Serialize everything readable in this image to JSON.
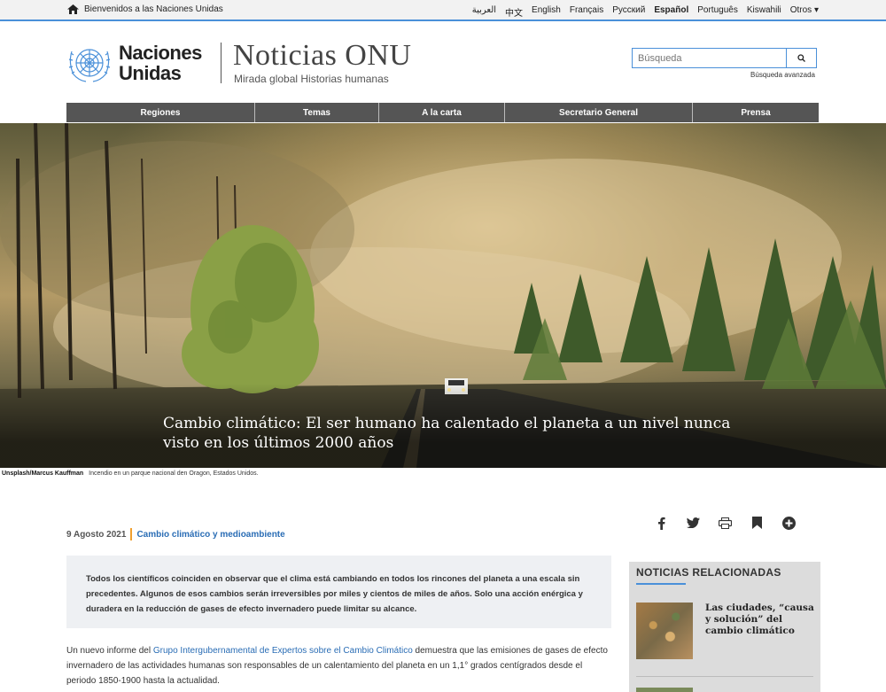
{
  "topbar": {
    "welcome": "Bienvenidos a las Naciones Unidas",
    "languages": [
      "العربية",
      "中文",
      "English",
      "Français",
      "Русский",
      "Español",
      "Português",
      "Kiswahili"
    ],
    "active_language": "Español",
    "more": "Otros"
  },
  "header": {
    "brand_line1": "Naciones",
    "brand_line2": "Unidas",
    "title": "Noticias ONU",
    "subtitle": "Mirada global Historias humanas",
    "search_placeholder": "Búsqueda",
    "advanced_search": "Búsqueda avanzada"
  },
  "nav": [
    "Regiones",
    "Temas",
    "A la carta",
    "Secretario General",
    "Prensa"
  ],
  "hero": {
    "title": "Cambio climático: El ser humano ha calentado el planeta a un nivel nunca visto en los últimos 2000 años",
    "credit_source": "Unsplash/Marcus Kauffman",
    "credit_caption": "Incendio en un parque nacional den Oragon, Estados Unidos."
  },
  "article": {
    "date": "9 Agosto 2021",
    "category": "Cambio climático y medioambiente",
    "summary": "Todos los científicos coinciden en observar que el clima está cambiando en todos los rincones del planeta a una escala sin precedentes. Algunos de esos cambios serán irreversibles por miles y cientos de miles de años. Solo una acción enérgica y duradera en la reducción de gases de efecto invernadero puede limitar su alcance.",
    "body_prefix": "Un nuevo informe del ",
    "body_link": "Grupo Intergubernamental de Expertos sobre el Cambio Climático",
    "body_suffix": " demuestra que las emisiones de gases de efecto invernadero de las actividades humanas son responsables de un calentamiento del planeta en un 1,1° grados centígrados desde el periodo 1850-1900 hasta la actualidad."
  },
  "share_icons": [
    "facebook-icon",
    "twitter-icon",
    "print-icon",
    "bookmark-icon",
    "plus-icon"
  ],
  "related": {
    "heading": "NOTICIAS RELACIONADAS",
    "items": [
      {
        "title": "Las ciudades, “causa y solución” del cambio climático"
      }
    ]
  }
}
